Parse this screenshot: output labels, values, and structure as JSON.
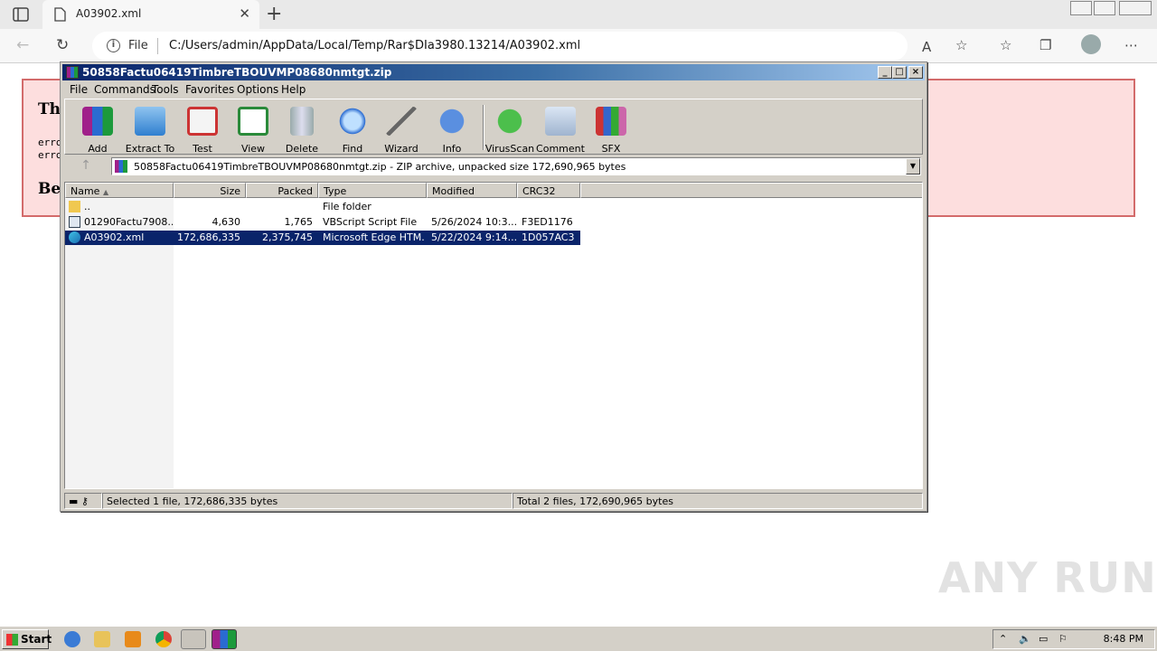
{
  "browser": {
    "tab_title": "A03902.xml",
    "address_scheme": "File",
    "address_url": "C:/Users/admin/AppData/Local/Temp/Rar$DIa3980.13214/A03902.xml",
    "new_tab_glyph": "+",
    "close_tab_glyph": "✕"
  },
  "error_page": {
    "heading_fragment": "Thi",
    "line1_fragment": "erro",
    "line2_fragment": "erro",
    "heading2_fragment": "Bel"
  },
  "winrar": {
    "title": "50858Factu06419TimbreTBOUVMP08680nmtgt.zip",
    "menu": [
      "File",
      "Commands",
      "Tools",
      "Favorites",
      "Options",
      "Help"
    ],
    "toolbar": [
      "Add",
      "Extract To",
      "Test",
      "View",
      "Delete",
      "Find",
      "Wizard",
      "Info",
      "VirusScan",
      "Comment",
      "SFX"
    ],
    "path": "50858Factu06419TimbreTBOUVMP08680nmtgt.zip - ZIP archive, unpacked size 172,690,965 bytes",
    "columns": [
      "Name",
      "Size",
      "Packed",
      "Type",
      "Modified",
      "CRC32"
    ],
    "rows": [
      {
        "name": "..",
        "size": "",
        "packed": "",
        "type": "File folder",
        "modified": "",
        "crc": ""
      },
      {
        "name": "01290Factu7908...",
        "size": "4,630",
        "packed": "1,765",
        "type": "VBScript Script File",
        "modified": "5/26/2024 10:3...",
        "crc": "F3ED1176"
      },
      {
        "name": "A03902.xml",
        "size": "172,686,335",
        "packed": "2,375,745",
        "type": "Microsoft Edge HTM...",
        "modified": "5/22/2024 9:14...",
        "crc": "1D057AC3"
      }
    ],
    "status_left": "Selected 1 file, 172,686,335 bytes",
    "status_right": "Total 2 files, 172,690,965 bytes"
  },
  "taskbar": {
    "start_label": "Start",
    "clock": "8:48 PM"
  },
  "watermark": "ANY RUN"
}
